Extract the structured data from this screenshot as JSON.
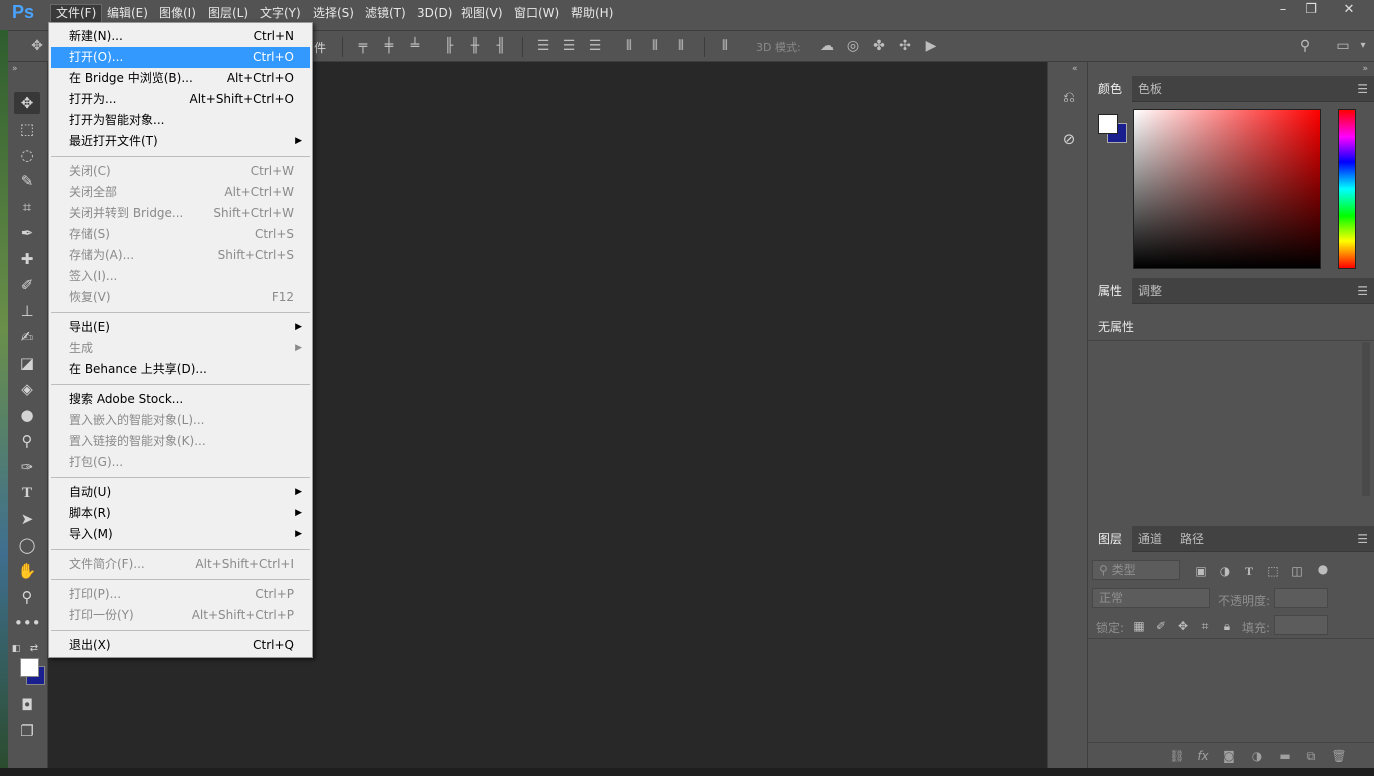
{
  "app": {
    "logo": "Ps"
  },
  "menubar": {
    "items": [
      "文件(F)",
      "编辑(E)",
      "图像(I)",
      "图层(L)",
      "文字(Y)",
      "选择(S)",
      "滤镜(T)",
      "3D(D)",
      "视图(V)",
      "窗口(W)",
      "帮助(H)"
    ],
    "window_buttons": {
      "minimize": "–",
      "restore": "❐",
      "close": "✕"
    }
  },
  "options_bar": {
    "label_3d": "3D 模式:",
    "partial_label": "件"
  },
  "file_menu": {
    "groups": [
      [
        {
          "label": "新建(N)...",
          "shortcut": "Ctrl+N",
          "disabled": false
        },
        {
          "label": "打开(O)...",
          "shortcut": "Ctrl+O",
          "disabled": false,
          "highlight": true
        },
        {
          "label": "在 Bridge 中浏览(B)...",
          "shortcut": "Alt+Ctrl+O",
          "disabled": false
        },
        {
          "label": "打开为...",
          "shortcut": "Alt+Shift+Ctrl+O",
          "disabled": false
        },
        {
          "label": "打开为智能对象...",
          "shortcut": "",
          "disabled": false
        },
        {
          "label": "最近打开文件(T)",
          "shortcut": "",
          "disabled": false,
          "submenu": true
        }
      ],
      [
        {
          "label": "关闭(C)",
          "shortcut": "Ctrl+W",
          "disabled": true
        },
        {
          "label": "关闭全部",
          "shortcut": "Alt+Ctrl+W",
          "disabled": true
        },
        {
          "label": "关闭并转到 Bridge...",
          "shortcut": "Shift+Ctrl+W",
          "disabled": true
        },
        {
          "label": "存储(S)",
          "shortcut": "Ctrl+S",
          "disabled": true
        },
        {
          "label": "存储为(A)...",
          "shortcut": "Shift+Ctrl+S",
          "disabled": true
        },
        {
          "label": "签入(I)...",
          "shortcut": "",
          "disabled": true
        },
        {
          "label": "恢复(V)",
          "shortcut": "F12",
          "disabled": true
        }
      ],
      [
        {
          "label": "导出(E)",
          "shortcut": "",
          "disabled": false,
          "submenu": true
        },
        {
          "label": "生成",
          "shortcut": "",
          "disabled": true,
          "submenu": true
        },
        {
          "label": "在 Behance 上共享(D)...",
          "shortcut": "",
          "disabled": false
        }
      ],
      [
        {
          "label": "搜索 Adobe Stock...",
          "shortcut": "",
          "disabled": false
        },
        {
          "label": "置入嵌入的智能对象(L)...",
          "shortcut": "",
          "disabled": true
        },
        {
          "label": "置入链接的智能对象(K)...",
          "shortcut": "",
          "disabled": true
        },
        {
          "label": "打包(G)...",
          "shortcut": "",
          "disabled": true
        }
      ],
      [
        {
          "label": "自动(U)",
          "shortcut": "",
          "disabled": false,
          "submenu": true
        },
        {
          "label": "脚本(R)",
          "shortcut": "",
          "disabled": false,
          "submenu": true
        },
        {
          "label": "导入(M)",
          "shortcut": "",
          "disabled": false,
          "submenu": true
        }
      ],
      [
        {
          "label": "文件简介(F)...",
          "shortcut": "Alt+Shift+Ctrl+I",
          "disabled": true
        }
      ],
      [
        {
          "label": "打印(P)...",
          "shortcut": "Ctrl+P",
          "disabled": true
        },
        {
          "label": "打印一份(Y)",
          "shortcut": "Alt+Shift+Ctrl+P",
          "disabled": true
        }
      ],
      [
        {
          "label": "退出(X)",
          "shortcut": "Ctrl+Q",
          "disabled": false
        }
      ]
    ]
  },
  "color_panel": {
    "tabs": [
      "颜色",
      "色板"
    ],
    "foreground": "#ffffff",
    "background": "#1a1f8f"
  },
  "properties_panel": {
    "tabs": [
      "属性",
      "调整"
    ],
    "empty_text": "无属性"
  },
  "layers_panel": {
    "tabs": [
      "图层",
      "通道",
      "路径"
    ],
    "filter_placeholder": "类型",
    "blend_mode": "正常",
    "opacity_label": "不透明度:",
    "lock_label": "锁定:",
    "fill_label": "填充:"
  }
}
